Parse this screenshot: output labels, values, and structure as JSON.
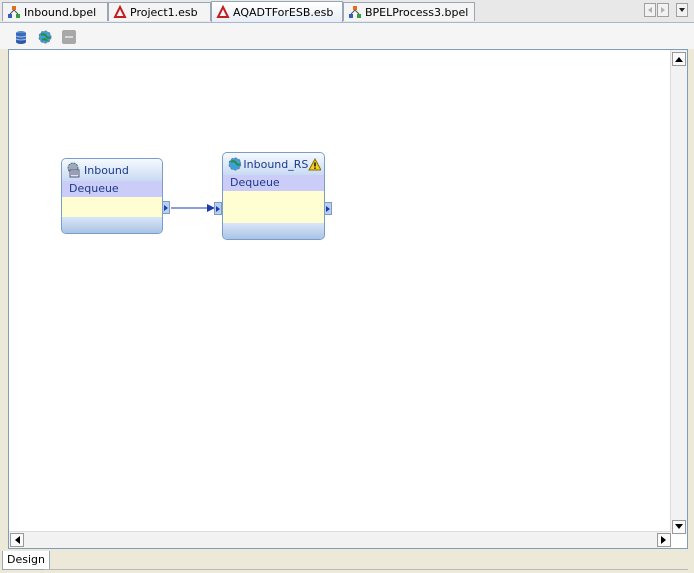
{
  "tabs": [
    {
      "label": "Inbound.bpel",
      "icon": "bpel-icon"
    },
    {
      "label": "Project1.esb",
      "icon": "esb-icon"
    },
    {
      "label": "AQADTForESB.esb",
      "icon": "esb-icon"
    },
    {
      "label": "BPELProcess3.bpel",
      "icon": "bpel-icon"
    }
  ],
  "active_tab": 2,
  "nodes": {
    "inbound": {
      "title": "Inbound",
      "operation": "Dequeue"
    },
    "inbound_rs": {
      "title": "Inbound_RS",
      "operation": "Dequeue",
      "warning": true
    }
  },
  "bottom_tab": {
    "label": "Design"
  }
}
